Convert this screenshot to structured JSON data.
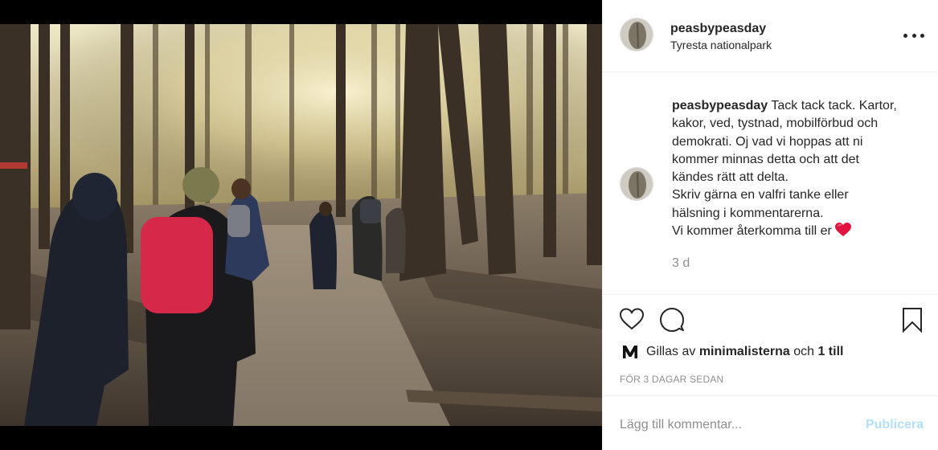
{
  "post": {
    "username": "peasbypeasday",
    "location": "Tyresta nationalpark",
    "caption": {
      "username": "peasbypeasday",
      "lines": [
        "Tack tack tack. Kartor,",
        "kakor, ved, tystnad, mobilförbud och",
        "demokrati. Oj vad vi hoppas att ni",
        "kommer minnas detta och att det",
        "kändes rätt att delta.",
        "Skriv gärna en valfri tanke eller",
        "hälsning i kommentarerna.",
        "Vi kommer återkomma till er"
      ],
      "emoji": "red-heart-icon"
    },
    "time_ago": "3 d",
    "likes": {
      "prefix": "Gillas av",
      "user": "minimalisterna",
      "conjunction": "och",
      "others": "1 till"
    },
    "date_label": "FÖR 3 DAGAR SEDAN"
  },
  "comment": {
    "placeholder": "Lägg till kommentar...",
    "publish_label": "Publicera"
  },
  "icons": {
    "more": "more-options-icon",
    "like": "heart-icon",
    "comment": "comment-bubble-icon",
    "save": "bookmark-icon",
    "liker_avatar": "m-logo-icon"
  },
  "colors": {
    "text": "#262626",
    "secondary": "#8e8e8e",
    "border": "#efefef",
    "publish_disabled": "#b2dffc",
    "heart_emoji": "#e0143c"
  }
}
